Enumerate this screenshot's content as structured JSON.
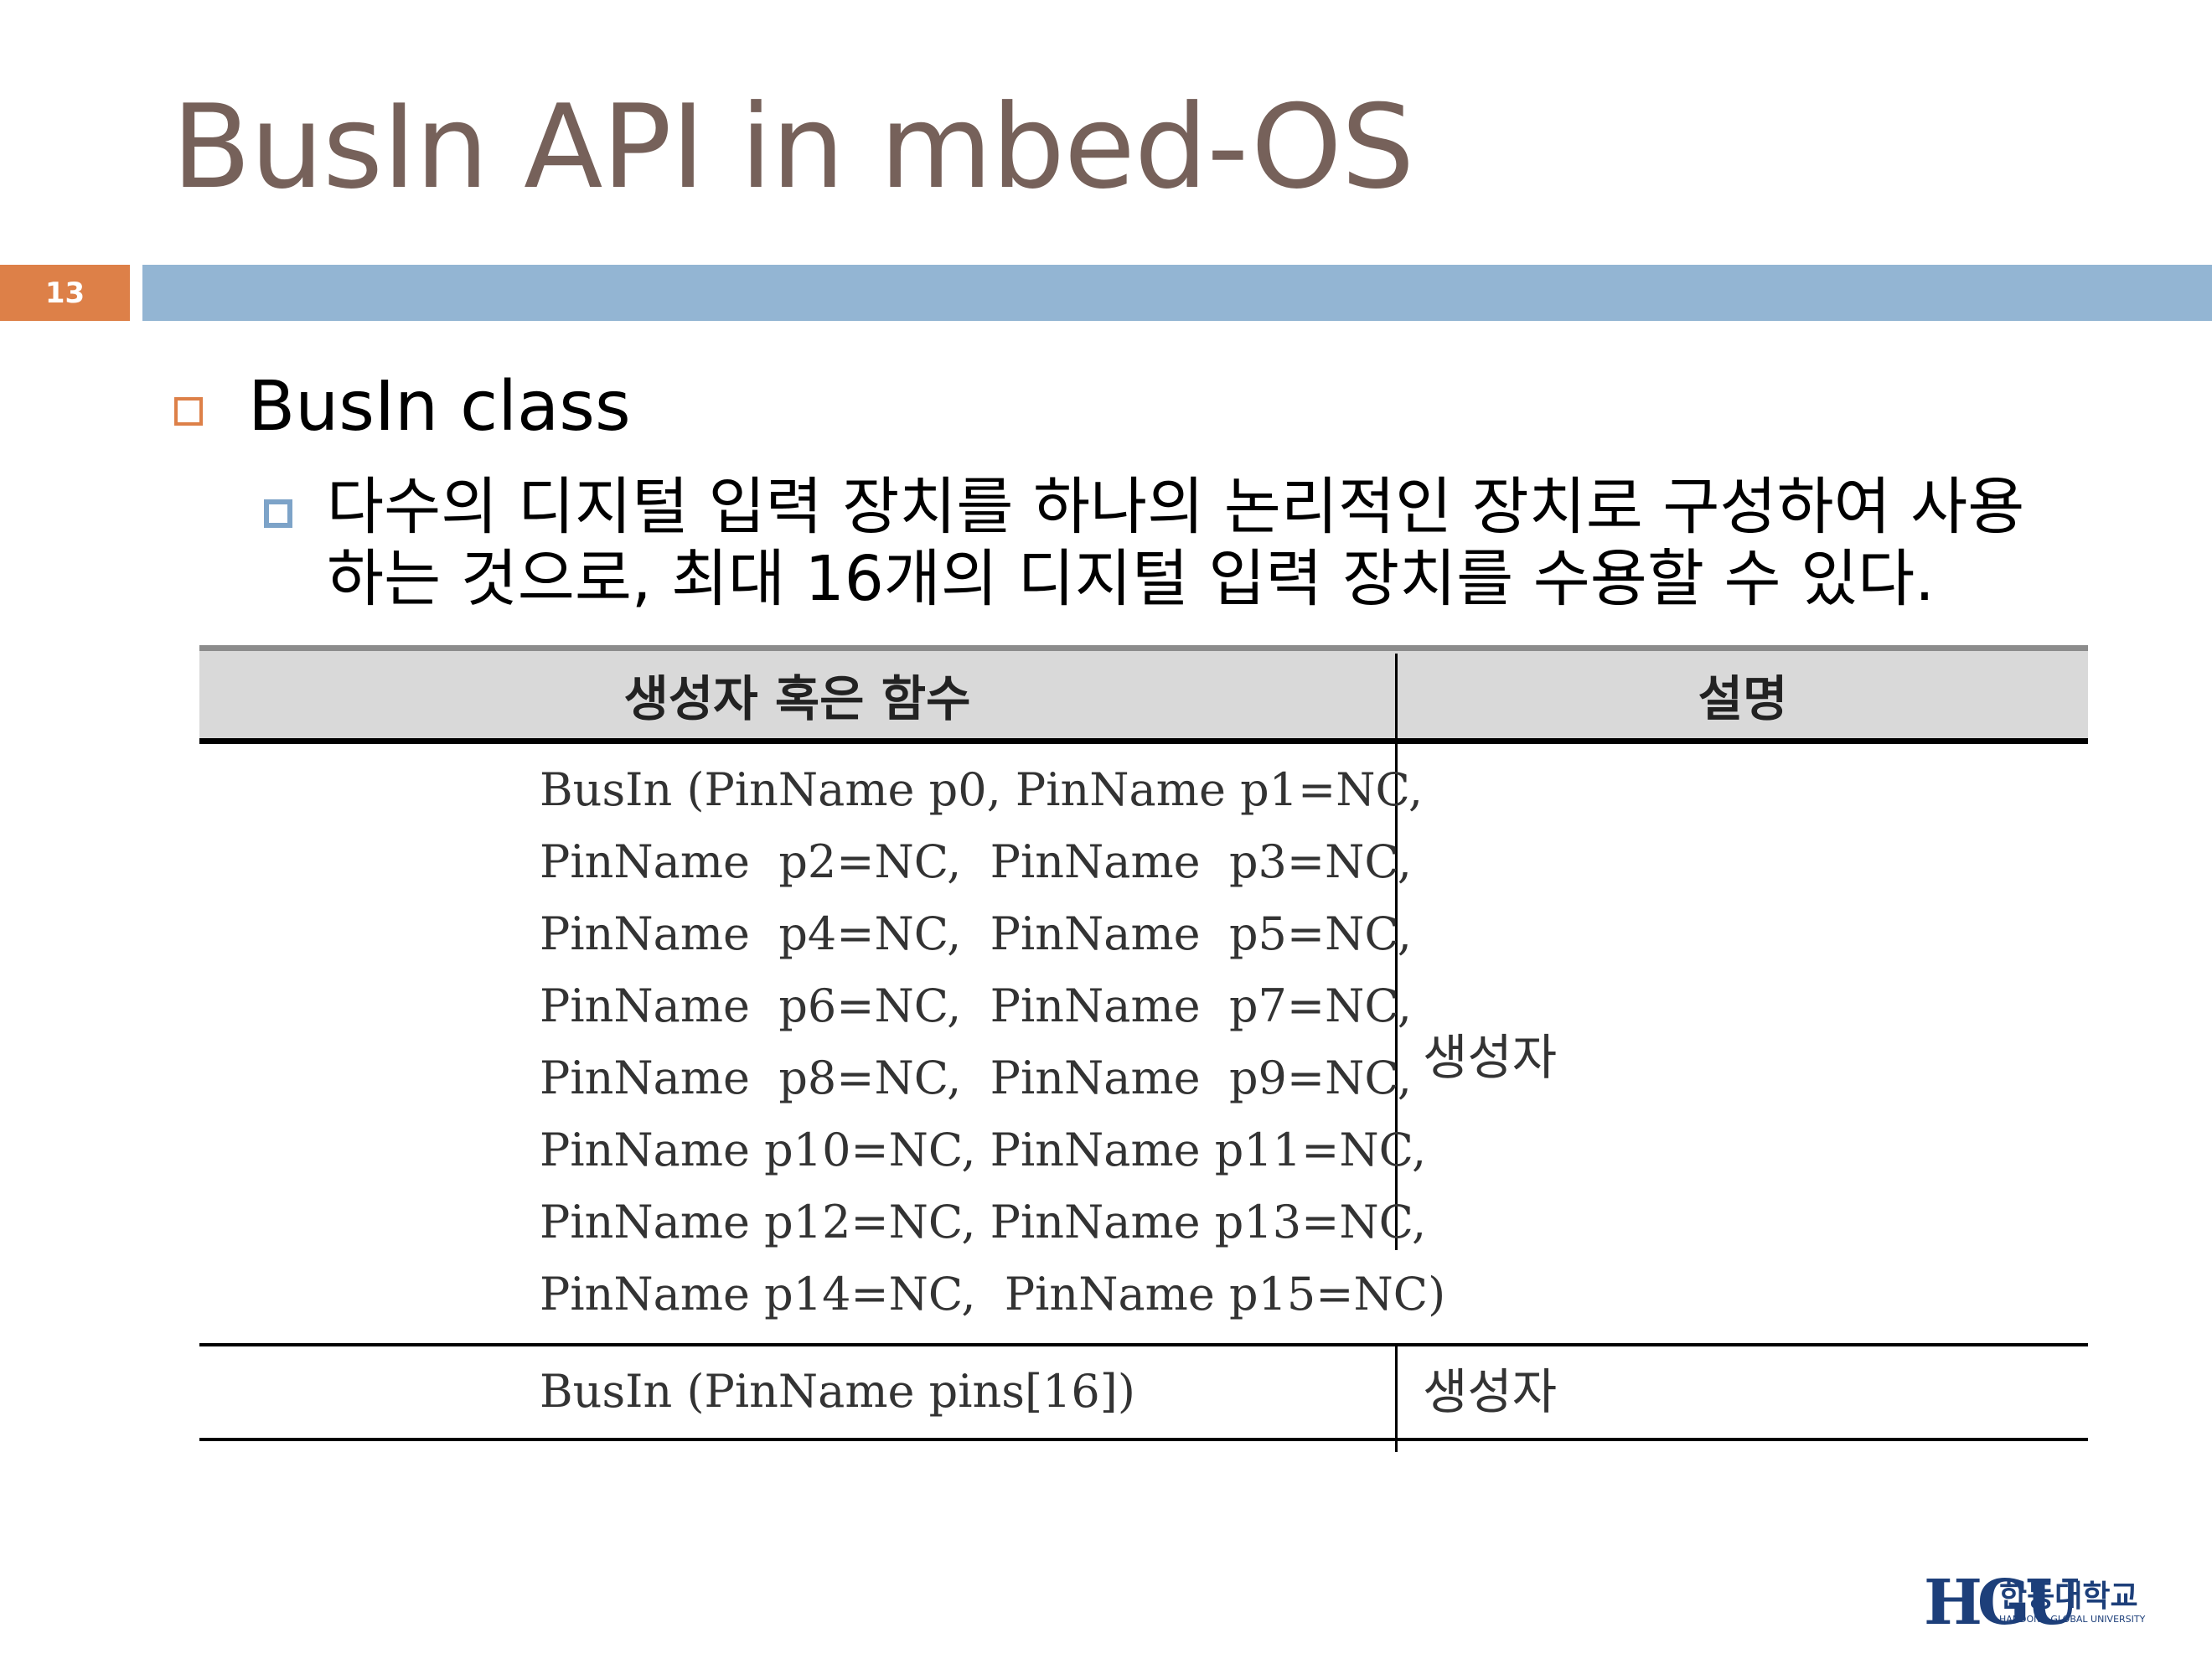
{
  "slide": {
    "title": "BusIn API in mbed-OS",
    "page_number": "13"
  },
  "bullets": {
    "level1": "BusIn class",
    "level2": "다수의 디지털 입력 장치를 하나의 논리적인 장치로 구성하여 사용하는 것으로, 최대 16개의 디지털 입력 장치를 수용할 수 있다."
  },
  "table": {
    "headers": [
      "생성자 혹은 함수",
      "설명"
    ],
    "rows": [
      {
        "code": [
          "BusIn (PinName p0, PinName p1=NC,",
          "PinName  p2=NC,  PinName  p3=NC,",
          "PinName  p4=NC,  PinName  p5=NC,",
          "PinName  p6=NC,  PinName  p7=NC,",
          "PinName  p8=NC,  PinName  p9=NC,",
          "PinName p10=NC, PinName p11=NC,",
          "PinName p12=NC, PinName p13=NC,",
          "PinName p14=NC,  PinName p15=NC)"
        ],
        "description": "생성자"
      },
      {
        "code": [
          "BusIn (PinName pins[16])"
        ],
        "description": "생성자"
      }
    ]
  },
  "logo": {
    "mark": "HGU",
    "korean": "한동대학교",
    "english": "HANDONG GLOBAL UNIVERSITY"
  },
  "colors": {
    "title": "#76615a",
    "accent_orange": "#dd8048",
    "accent_blue": "#93b5d3"
  }
}
